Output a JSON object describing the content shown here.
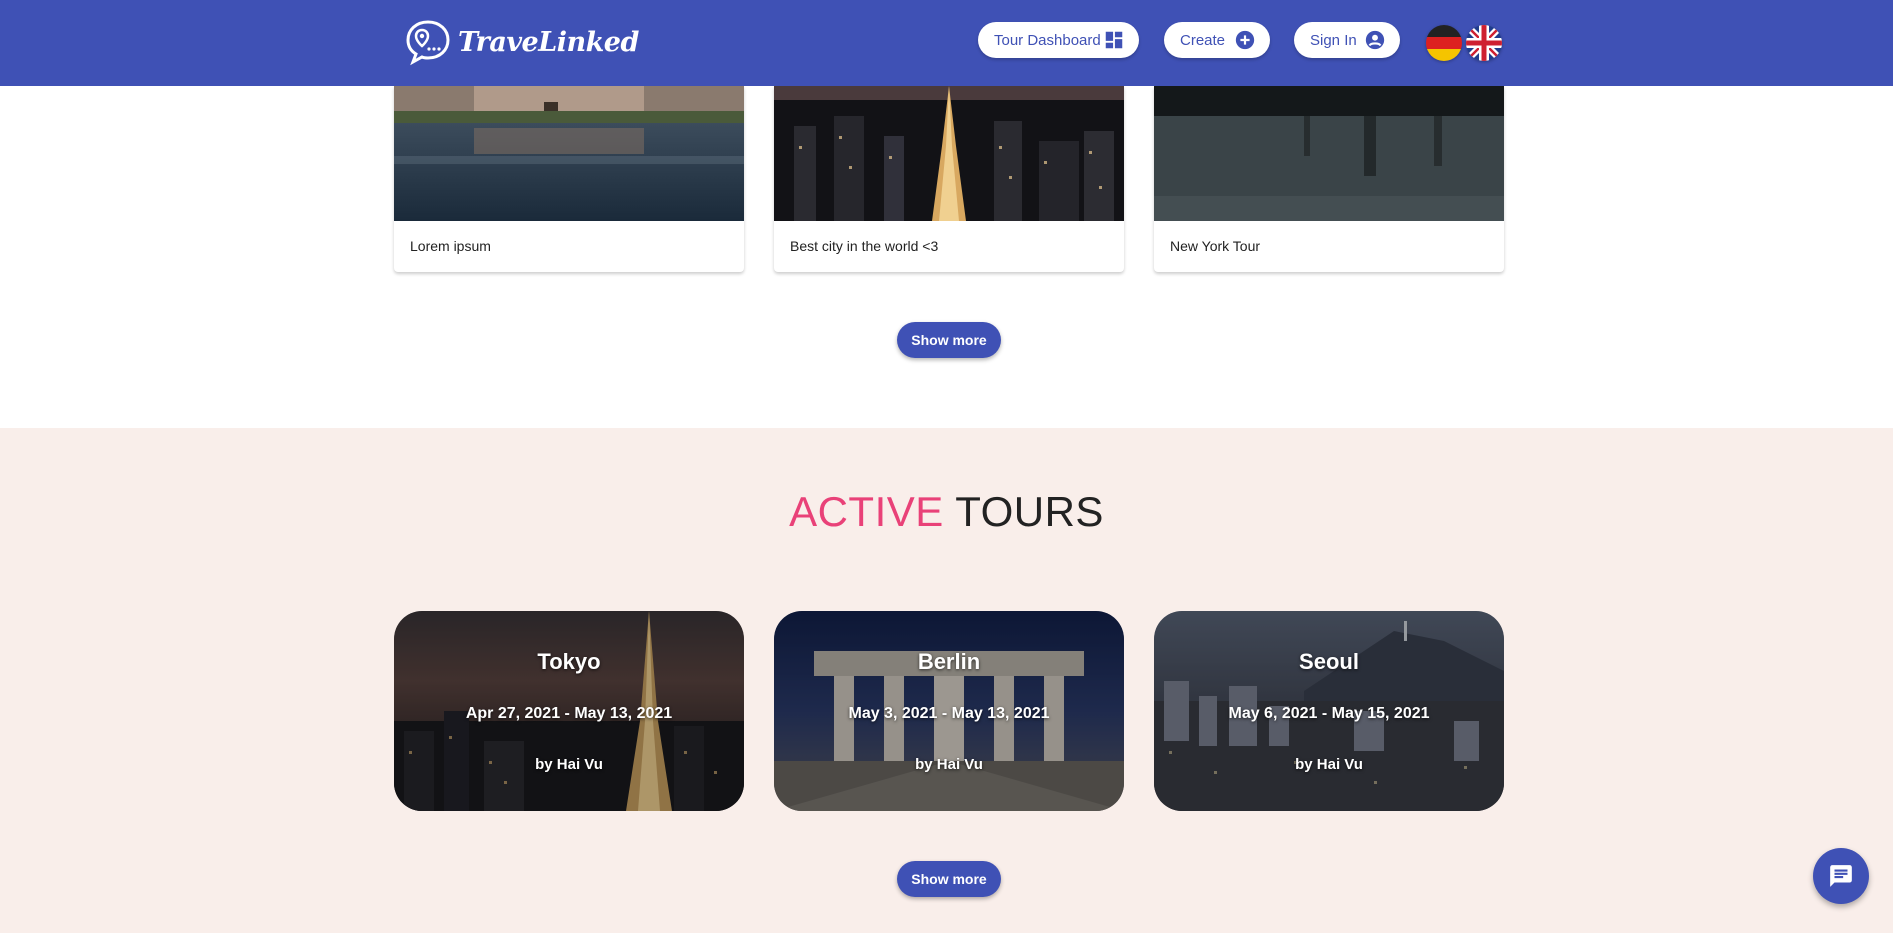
{
  "header": {
    "logo_text": "TraveLinked",
    "nav": {
      "dashboard_label": "Tour Dashboard",
      "create_label": "Create",
      "signin_label": "Sign In"
    },
    "languages": [
      "de",
      "en"
    ]
  },
  "recent_tours": {
    "cards": [
      {
        "label": "Lorem ipsum"
      },
      {
        "label": "Best city in the world <3"
      },
      {
        "label": "New York Tour"
      }
    ],
    "show_more_label": "Show more"
  },
  "active_tours": {
    "title_highlight": "ACTIVE",
    "title_rest": "TOURS",
    "cards": [
      {
        "city": "Tokyo",
        "dates": "Apr 27, 2021 - May 13, 2021",
        "by": "by Hai Vu"
      },
      {
        "city": "Berlin",
        "dates": "May 3, 2021 - May 13, 2021",
        "by": "by Hai Vu"
      },
      {
        "city": "Seoul",
        "dates": "May 6, 2021 - May 15, 2021",
        "by": "by Hai Vu"
      }
    ],
    "show_more_label": "Show more"
  },
  "colors": {
    "primary": "#3f51b5",
    "accent": "#e94178",
    "section_bg": "#f9eeea"
  },
  "icons": [
    "dashboard-icon",
    "add-circle-icon",
    "account-circle-icon",
    "chat-icon"
  ]
}
